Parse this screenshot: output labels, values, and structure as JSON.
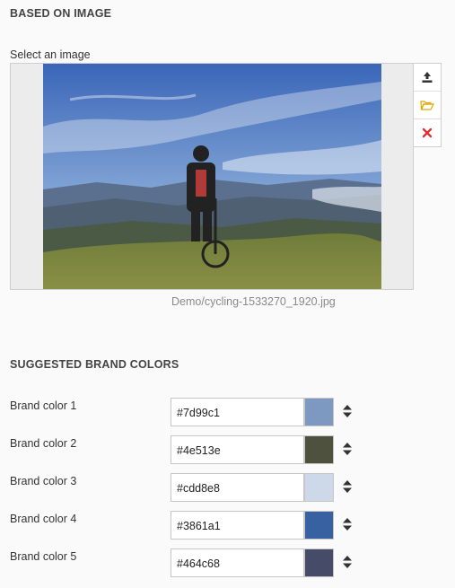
{
  "based_section": {
    "title": "BASED ON IMAGE",
    "select_label": "Select an image",
    "file_name": "Demo/cycling-1533270_1920.jpg"
  },
  "side_buttons": [
    {
      "icon": "upload-icon",
      "color": "#333333"
    },
    {
      "icon": "folder-open-icon",
      "color": "#e0a800"
    },
    {
      "icon": "close-icon",
      "color": "#e03030"
    }
  ],
  "suggested_section": {
    "title": "SUGGESTED BRAND COLORS",
    "colors": [
      {
        "label": "Brand color 1",
        "value": "#7d99c1"
      },
      {
        "label": "Brand color 2",
        "value": "#4e513e"
      },
      {
        "label": "Brand color 3",
        "value": "#cdd8e8"
      },
      {
        "label": "Brand color 4",
        "value": "#3861a1"
      },
      {
        "label": "Brand color 5",
        "value": "#464c68"
      }
    ]
  }
}
